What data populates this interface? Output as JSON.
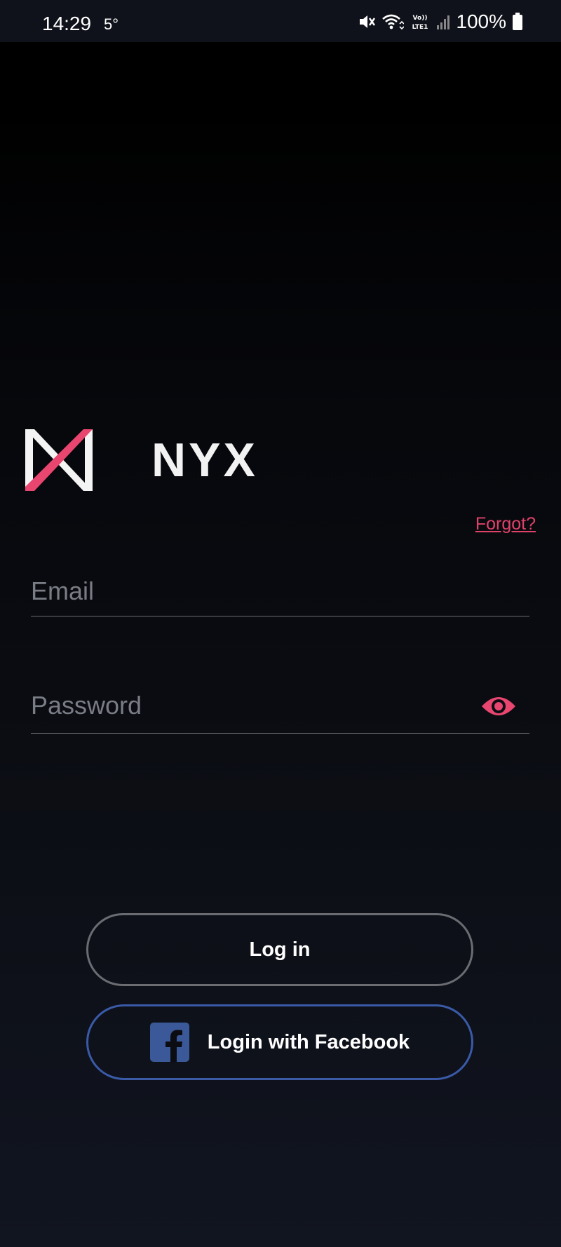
{
  "status_bar": {
    "time": "14:29",
    "temperature": "5°",
    "battery": "100%",
    "signal_label": "VoLTE1"
  },
  "logo": {
    "text": "NYX",
    "accent_color": "#e8456f"
  },
  "login_form": {
    "forgot_label": "Forgot?",
    "email_placeholder": "Email",
    "email_value": "",
    "password_placeholder": "Password",
    "password_value": ""
  },
  "buttons": {
    "login_label": "Log in",
    "facebook_label": "Login with Facebook"
  },
  "colors": {
    "accent": "#e0426a",
    "facebook": "#3b5998",
    "background": "#0b0d13"
  }
}
